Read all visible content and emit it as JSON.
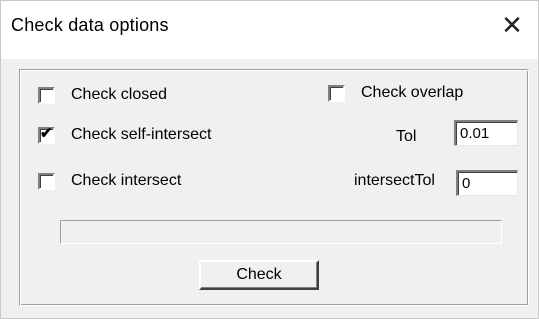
{
  "window": {
    "title": "Check data options",
    "close_glyph": "✕",
    "close_icon": "close-icon"
  },
  "options": {
    "check_closed": {
      "label": "Check closed",
      "checked": false
    },
    "check_self_intersect": {
      "label": "Check self-intersect",
      "checked": true
    },
    "check_intersect": {
      "label": "Check intersect",
      "checked": false
    },
    "check_overlap": {
      "label": "Check overlap",
      "checked": false
    }
  },
  "tol": {
    "label": "Tol",
    "value": "0.01"
  },
  "intersect_tol": {
    "label": "intersectTol",
    "value": "0"
  },
  "progress": {
    "value": 0
  },
  "check_button": {
    "label": "Check"
  }
}
